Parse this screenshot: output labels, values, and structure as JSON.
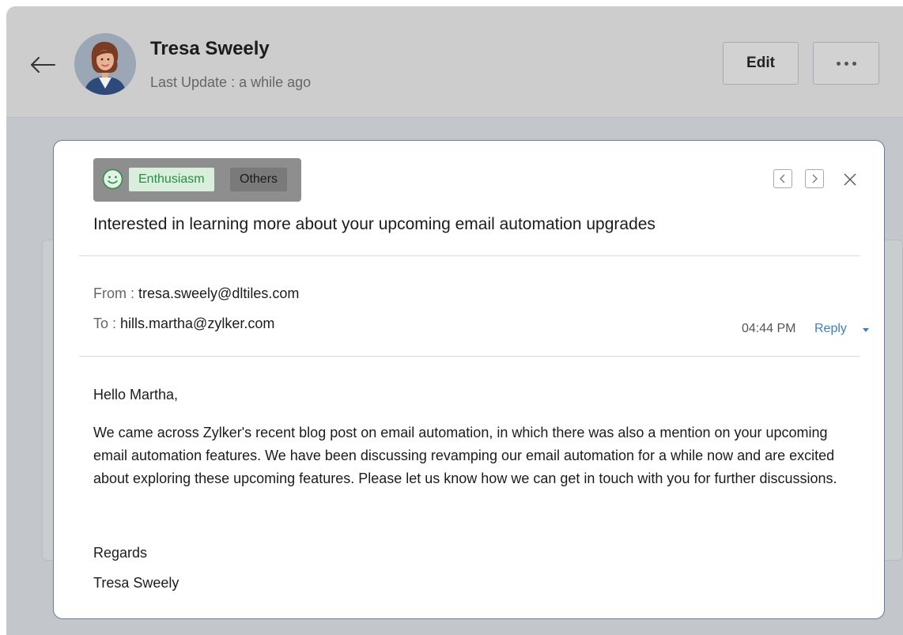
{
  "header": {
    "contact_name": "Tresa Sweely",
    "last_update": "Last Update : a while ago",
    "edit_label": "Edit"
  },
  "email": {
    "tags": {
      "sentiment": "Enthusiasm",
      "category": "Others"
    },
    "subject": "Interested in learning more about your upcoming email automation upgrades",
    "from_label": "From :",
    "from_value": "tresa.sweely@dltiles.com",
    "to_label": "To :",
    "to_value": "hills.martha@zylker.com",
    "time": "04:44 PM",
    "reply_label": "Reply",
    "greeting": "Hello Martha,",
    "paragraph": "We came across Zylker's recent blog post on email automation, in which there was also a mention on your upcoming email automation features. We have been discussing revamping our email automation for a while now and are excited about exploring these upcoming features. Please let us know how we can get in touch with you for further discussions.",
    "closing": "Regards",
    "signature": "Tresa Sweely"
  },
  "icons": {
    "back": "arrow-left-icon",
    "more": "more-horizontal-icon",
    "sentiment": "smiley-icon",
    "prev": "chevron-left-icon",
    "next": "chevron-right-icon",
    "close": "close-icon",
    "reply_menu": "caret-down-icon"
  },
  "colors": {
    "positive_tag_bg": "#d9efdc",
    "positive_tag_text": "#2d8a4a",
    "link": "#3d7fc4",
    "card_border": "#6b7b90"
  }
}
